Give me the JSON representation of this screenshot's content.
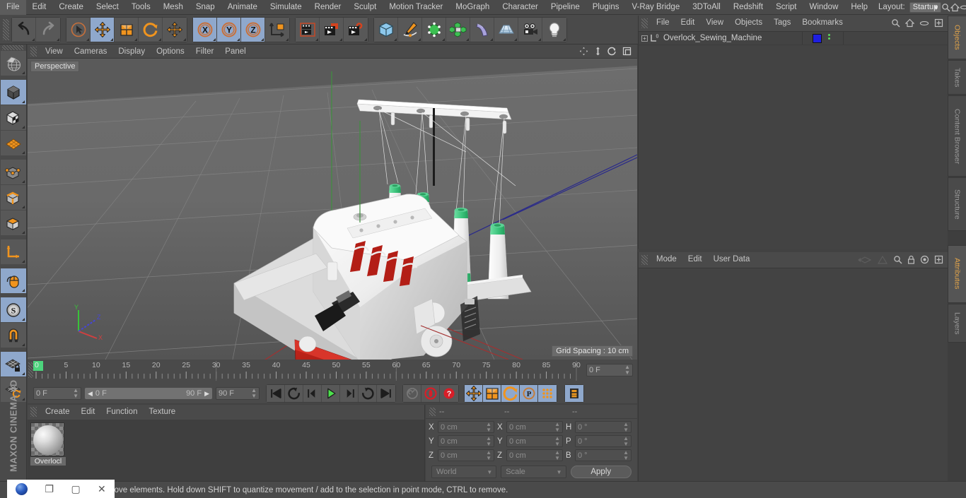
{
  "app": {
    "brand": "MAXON",
    "product": "CINEMA 4D"
  },
  "menubar": {
    "items": [
      "File",
      "Edit",
      "Create",
      "Select",
      "Tools",
      "Mesh",
      "Snap",
      "Animate",
      "Simulate",
      "Render",
      "Sculpt",
      "Motion Tracker",
      "MoGraph",
      "Character",
      "Pipeline",
      "Plugins",
      "V-Ray Bridge",
      "3DToAll",
      "Redshift",
      "Script",
      "Window",
      "Help"
    ],
    "layout_label": "Layout:",
    "layout_value": "Startup",
    "right_icons": [
      "search-icon",
      "home-icon",
      "minimize-icon",
      "maximize-icon"
    ]
  },
  "toolbar": {
    "groups": [
      {
        "name": "history",
        "buttons": [
          {
            "name": "undo",
            "icon": "undo-arrow-icon",
            "active": false
          },
          {
            "name": "redo",
            "icon": "redo-arrow-icon",
            "active": false
          }
        ]
      },
      {
        "name": "tools",
        "buttons": [
          {
            "name": "live-selection",
            "icon": "cursor-select-icon",
            "active": false
          },
          {
            "name": "move",
            "icon": "move-arrows-icon",
            "active": true
          },
          {
            "name": "scale",
            "icon": "scale-box-icon",
            "active": false
          },
          {
            "name": "rotate",
            "icon": "rotate-circle-icon",
            "active": false
          },
          {
            "name": "move-duplicate",
            "icon": "move-arrows-icon",
            "active": false
          }
        ]
      },
      {
        "name": "axis-locks",
        "buttons": [
          {
            "name": "lock-x",
            "icon": "axis-x-icon",
            "active": true
          },
          {
            "name": "lock-y",
            "icon": "axis-y-icon",
            "active": true
          },
          {
            "name": "lock-z",
            "icon": "axis-z-icon",
            "active": true
          },
          {
            "name": "world-object-axis",
            "icon": "world-axis-icon",
            "active": false
          }
        ]
      },
      {
        "name": "render",
        "buttons": [
          {
            "name": "render-view",
            "icon": "render-view-icon",
            "active": false
          },
          {
            "name": "render-region",
            "icon": "render-region-icon",
            "active": false
          },
          {
            "name": "render-settings",
            "icon": "render-settings-icon",
            "active": false
          }
        ]
      },
      {
        "name": "objects",
        "buttons": [
          {
            "name": "add-cube",
            "icon": "cube-icon",
            "active": false
          },
          {
            "name": "add-spline",
            "icon": "pen-spline-icon",
            "active": false
          },
          {
            "name": "add-generator",
            "icon": "green-cube-icon",
            "active": false
          },
          {
            "name": "add-array",
            "icon": "array-icon",
            "active": false
          },
          {
            "name": "add-deformer",
            "icon": "bend-deformer-icon",
            "active": false
          },
          {
            "name": "add-scene",
            "icon": "floor-scene-icon",
            "active": false
          },
          {
            "name": "add-camera",
            "icon": "camera-icon",
            "active": false
          },
          {
            "name": "add-light",
            "icon": "light-bulb-icon",
            "active": false
          }
        ]
      }
    ]
  },
  "left_toolbar": {
    "buttons": [
      {
        "name": "undo-view",
        "icon": "globe-wire-icon",
        "active": false
      },
      {
        "name": "model-mode",
        "icon": "dark-cube-icon",
        "active": true
      },
      {
        "name": "texture-mode",
        "icon": "checker-cube-icon",
        "active": false
      },
      {
        "name": "workplane",
        "icon": "orange-grid-icon",
        "active": false
      },
      {
        "name": "points-mode",
        "icon": "points-cube-icon",
        "active": false
      },
      {
        "name": "edges-mode",
        "icon": "edges-cube-icon",
        "active": false
      },
      {
        "name": "polygons-mode",
        "icon": "poly-cube-icon",
        "active": false
      },
      {
        "name": "axis-modify",
        "icon": "axis-arrow-icon",
        "active": false
      },
      {
        "name": "enable-snapping",
        "icon": "mouse-icon",
        "active": true
      },
      {
        "name": "soft-selection",
        "icon": "s-circle-icon",
        "active": true
      },
      {
        "name": "magnet",
        "icon": "magnet-icon",
        "active": false
      },
      {
        "name": "workplane-lock",
        "icon": "grid-lock-icon",
        "active": true
      },
      {
        "name": "workplane-rotate",
        "icon": "grid-rotate-icon",
        "active": false
      }
    ]
  },
  "viewport": {
    "menu": [
      "View",
      "Cameras",
      "Display",
      "Options",
      "Filter",
      "Panel"
    ],
    "nav_icons": [
      "pan-icon",
      "dolly-icon",
      "rotate-icon",
      "maximize-icon"
    ],
    "label": "Perspective",
    "grid_spacing": "Grid Spacing : 10 cm",
    "axis": {
      "x": "X",
      "y": "Y",
      "z": "Z",
      "x_color": "#d03030",
      "y_color": "#30c030",
      "z_color": "#3030d0"
    },
    "model": {
      "name": "Overlock_Sewing_Machine",
      "body_color": "#e8e8e8",
      "accent_color": "#b31e16",
      "spool_cap_color": "#3cc47c",
      "spool_count": 4
    }
  },
  "timeline": {
    "ticks": [
      "0",
      "5",
      "10",
      "15",
      "20",
      "25",
      "30",
      "35",
      "40",
      "45",
      "50",
      "55",
      "60",
      "65",
      "70",
      "75",
      "80",
      "85",
      "90"
    ],
    "current_frame": "0 F",
    "range_start": "0 F",
    "range_end": "90 F",
    "end_frame": "90 F",
    "frame_field_right": "0 F",
    "playback_buttons": [
      {
        "name": "go-to-start",
        "icon": "skip-start-icon"
      },
      {
        "name": "previous-key",
        "icon": "prev-key-icon"
      },
      {
        "name": "step-back",
        "icon": "step-back-icon"
      },
      {
        "name": "play-forward",
        "icon": "play-icon"
      },
      {
        "name": "step-forward",
        "icon": "step-forward-icon"
      },
      {
        "name": "next-key",
        "icon": "next-key-icon"
      },
      {
        "name": "go-to-end",
        "icon": "skip-end-icon"
      }
    ],
    "record_buttons": [
      {
        "name": "autokeying",
        "icon": "key-icon",
        "active": false
      },
      {
        "name": "record-active-objects",
        "icon": "record-icon",
        "active": false
      },
      {
        "name": "keyframe-selection",
        "icon": "question-key-icon",
        "active": false
      }
    ],
    "param_buttons": [
      {
        "name": "record-position",
        "icon": "move-arrows-icon",
        "active": true
      },
      {
        "name": "record-scale",
        "icon": "scale-box-icon",
        "active": true
      },
      {
        "name": "record-rotation",
        "icon": "rotate-circle-icon",
        "active": true
      },
      {
        "name": "record-parameter",
        "icon": "p-circle-icon",
        "active": true
      },
      {
        "name": "record-pla",
        "icon": "point-grid-icon",
        "active": true
      }
    ],
    "extra_button": {
      "name": "timeline-toggle",
      "icon": "film-strip-icon",
      "active": true
    }
  },
  "material_manager": {
    "menu": [
      "Create",
      "Edit",
      "Function",
      "Texture"
    ],
    "materials": [
      {
        "name": "Overlocl"
      }
    ]
  },
  "coordinates": {
    "headers": [
      "--",
      "--",
      "--"
    ],
    "rows": [
      {
        "pos_label": "X",
        "pos_value": "0 cm",
        "size_label": "X",
        "size_value": "0 cm",
        "rot_label": "H",
        "rot_value": "0 °"
      },
      {
        "pos_label": "Y",
        "pos_value": "0 cm",
        "size_label": "Y",
        "size_value": "0 cm",
        "rot_label": "P",
        "rot_value": "0 °"
      },
      {
        "pos_label": "Z",
        "pos_value": "0 cm",
        "size_label": "Z",
        "size_value": "0 cm",
        "rot_label": "B",
        "rot_value": "0 °"
      }
    ],
    "coord_system": "World",
    "transform_mode": "Scale",
    "apply_label": "Apply"
  },
  "object_manager": {
    "menu": [
      "File",
      "Edit",
      "View",
      "Objects",
      "Tags",
      "Bookmarks"
    ],
    "icons": [
      "search-icon",
      "home-icon",
      "eye-icon",
      "add-layer-icon"
    ],
    "objects": [
      {
        "name": "Overlock_Sewing_Machine",
        "layer_badge": "0",
        "tag_color": "#1f1fe0"
      }
    ]
  },
  "attribute_manager": {
    "menu": [
      "Mode",
      "Edit",
      "User Data"
    ],
    "icons": [
      "back-nav-icon",
      "forward-nav-icon",
      "search-icon",
      "lock-icon",
      "target-icon",
      "add-icon"
    ]
  },
  "vertical_tabs": {
    "top": [
      {
        "label": "Objects",
        "active": true
      },
      {
        "label": "Takes",
        "active": false
      },
      {
        "label": "Content Browser",
        "active": false
      },
      {
        "label": "Structure",
        "active": false
      }
    ],
    "bottom": [
      {
        "label": "Attributes",
        "active": true
      },
      {
        "label": "Layers",
        "active": false
      }
    ]
  },
  "statusbar": {
    "text": "move elements. Hold down SHIFT to quantize movement / add to the selection in point mode, CTRL to remove.",
    "window_controls": [
      "app-icon",
      "restore-icon",
      "minimize-icon",
      "close-icon"
    ]
  }
}
